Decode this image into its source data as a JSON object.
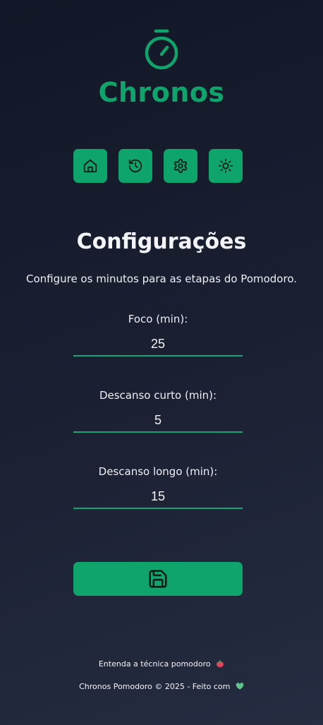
{
  "app": {
    "title": "Chronos",
    "accent_color": "#0fa46c",
    "logo_icon": "stopwatch-icon"
  },
  "nav": {
    "items": [
      {
        "icon": "home-icon"
      },
      {
        "icon": "history-icon"
      },
      {
        "icon": "settings-gear-icon"
      },
      {
        "icon": "sun-theme-icon"
      }
    ]
  },
  "settings": {
    "title": "Configurações",
    "description": "Configure os minutos para as etapas do Pomodoro.",
    "fields": [
      {
        "label": "Foco (min):",
        "value": "25"
      },
      {
        "label": "Descanso curto (min):",
        "value": "5"
      },
      {
        "label": "Descanso longo (min):",
        "value": "15"
      }
    ],
    "save_icon": "save-floppy-icon"
  },
  "footer": {
    "link_text": "Entenda a técnica pomodoro",
    "link_emoji": "tomato-icon",
    "copyright": "Chronos Pomodoro © 2025 - Feito com",
    "heart_emoji": "green-heart-icon"
  }
}
